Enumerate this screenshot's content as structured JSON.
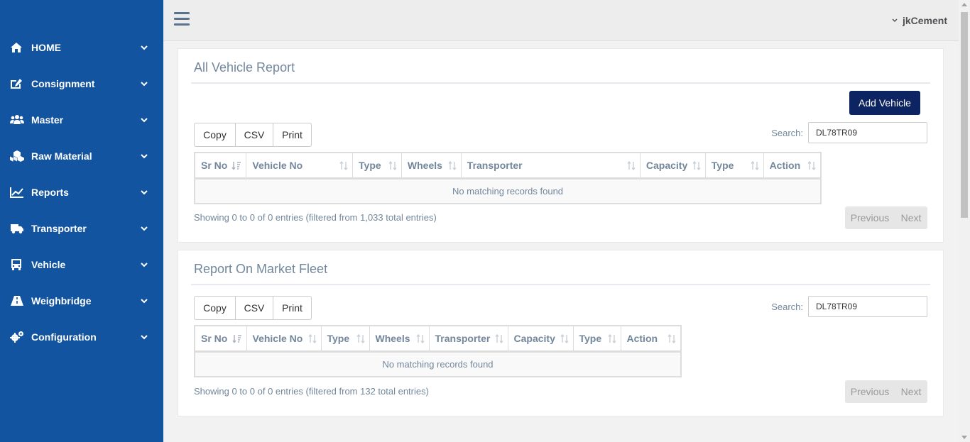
{
  "sidebar": {
    "items": [
      {
        "label": "HOME",
        "icon": "home-icon"
      },
      {
        "label": "Consignment",
        "icon": "edit-icon"
      },
      {
        "label": "Master",
        "icon": "users-icon"
      },
      {
        "label": "Raw Material",
        "icon": "cubes-icon"
      },
      {
        "label": "Reports",
        "icon": "line-chart-icon"
      },
      {
        "label": "Transporter",
        "icon": "truck-icon"
      },
      {
        "label": "Vehicle",
        "icon": "bus-icon"
      },
      {
        "label": "Weighbridge",
        "icon": "road-icon"
      },
      {
        "label": "Configuration",
        "icon": "cogs-icon"
      }
    ]
  },
  "header": {
    "user": "jkCement"
  },
  "vehicle_report": {
    "title": "All Vehicle Report",
    "add_button": "Add Vehicle",
    "buttons": {
      "copy": "Copy",
      "csv": "CSV",
      "print": "Print"
    },
    "search_label": "Search:",
    "search_value": "DL78TR09",
    "columns": [
      "Sr No",
      "Vehicle No",
      "Type",
      "Wheels",
      "Transporter",
      "Capacity",
      "Type",
      "Action"
    ],
    "empty_message": "No matching records found",
    "info": "Showing 0 to 0 of 0 entries (filtered from 1,033 total entries)",
    "pager": {
      "previous": "Previous",
      "next": "Next"
    }
  },
  "market_fleet": {
    "title": "Report On Market Fleet",
    "buttons": {
      "copy": "Copy",
      "csv": "CSV",
      "print": "Print"
    },
    "search_label": "Search:",
    "search_value": "DL78TR09",
    "columns": [
      "Sr No",
      "Vehicle No",
      "Type",
      "Wheels",
      "Transporter",
      "Capacity",
      "Type",
      "Action"
    ],
    "empty_message": "No matching records found",
    "info": "Showing 0 to 0 of 0 entries (filtered from 132 total entries)",
    "pager": {
      "previous": "Previous",
      "next": "Next"
    }
  },
  "colors": {
    "sidebar_bg": "#1254a0",
    "accent_button": "#0c2461",
    "topbar_bg": "#ededed",
    "text_muted": "#73879c"
  }
}
